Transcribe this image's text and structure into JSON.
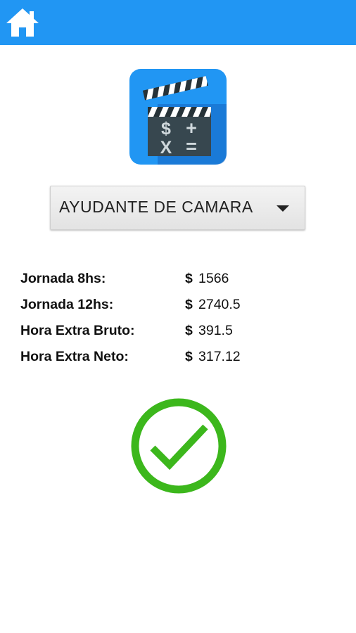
{
  "appbar": {
    "color": "#2196f3",
    "home_icon": "home-icon"
  },
  "app_icon": {
    "icon": "clapperboard-calculator-icon",
    "background": "#2196f3",
    "symbols": [
      "$",
      "+",
      "X",
      "="
    ]
  },
  "selector": {
    "selected": "AYUDANTE DE CAMARA",
    "arrow_icon": "dropdown-arrow-icon"
  },
  "rates": [
    {
      "label": "Jornada 8hs:",
      "currency": "$",
      "value": "1566"
    },
    {
      "label": "Jornada 12hs:",
      "currency": "$",
      "value": "2740.5"
    },
    {
      "label": "Hora Extra Bruto:",
      "currency": "$",
      "value": "391.5"
    },
    {
      "label": "Hora Extra Neto:",
      "currency": "$",
      "value": "317.12"
    }
  ],
  "status": {
    "icon": "checkmark-circle-icon",
    "color": "#3cb71c"
  }
}
